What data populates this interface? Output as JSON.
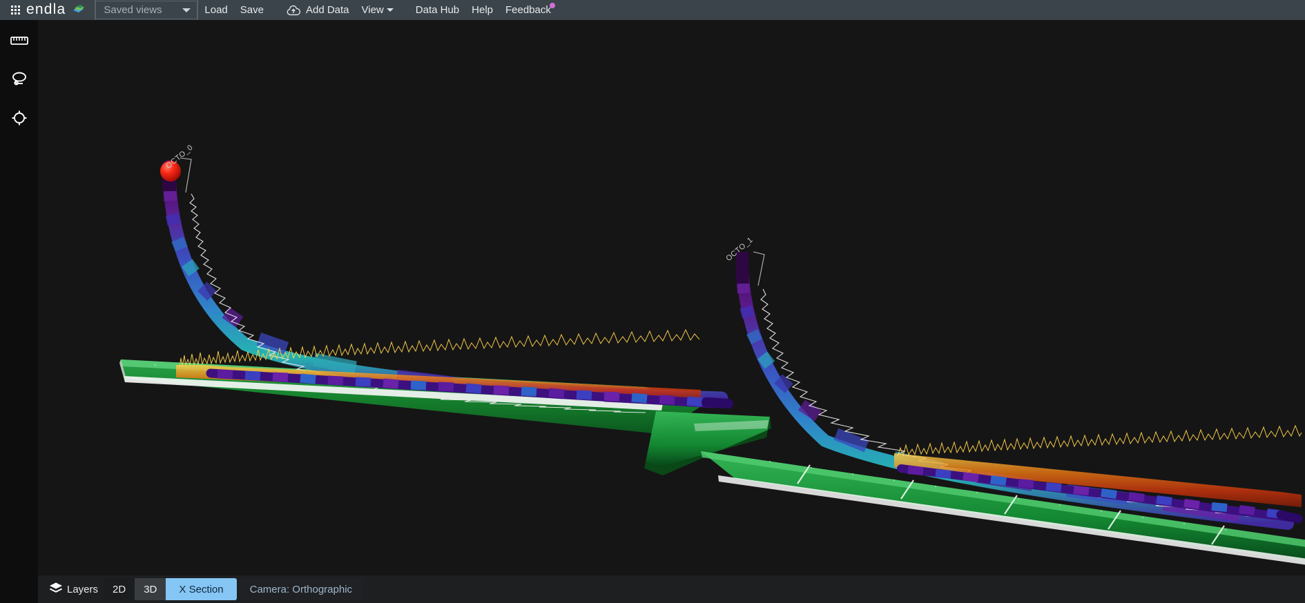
{
  "app": {
    "brand": "endla",
    "brand_icon": "layers-leaf-icon",
    "apps_icon": "apps-grid-icon"
  },
  "toolbar": {
    "saved_views": {
      "label": "Saved views",
      "icon": "chevron-down-icon"
    },
    "load_label": "Load",
    "save_label": "Save",
    "add_data": {
      "label": "Add Data",
      "icon": "cloud-upload-icon"
    },
    "view": {
      "label": "View",
      "icon": "chevron-down-icon"
    },
    "data_hub_label": "Data Hub",
    "help_label": "Help",
    "feedback_label": "Feedback",
    "feedback_badge_color": "#d46fd8"
  },
  "tool_rail": {
    "items": [
      {
        "name": "measure-tool",
        "icon": "ruler-icon"
      },
      {
        "name": "lasso-select-tool",
        "icon": "lasso-icon"
      },
      {
        "name": "target-tool",
        "icon": "crosshair-target-icon"
      }
    ]
  },
  "statusbar": {
    "layers_label": "Layers",
    "layers_icon": "layers-stack-icon",
    "view_modes": [
      {
        "label": "2D",
        "active": false
      },
      {
        "label": "3D",
        "active": false
      },
      {
        "label": "X Section",
        "active": true
      }
    ],
    "camera_label": "Camera: Orthographic",
    "active_color": "#85c6f5"
  },
  "viewport": {
    "background_color": "#151515",
    "wells": [
      {
        "name": "OCTO_0",
        "label": "OCTO_0",
        "marker": "red-sphere-marker",
        "marker_color": "#f51a0e"
      },
      {
        "name": "OCTO_1",
        "label": "OCTO_1",
        "marker": "none",
        "marker_color": ""
      }
    ],
    "surfaces": [
      {
        "name": "horizon-surface-upper",
        "color": "#1b7a36"
      },
      {
        "name": "horizon-surface-lower",
        "color": "#126a2b"
      }
    ],
    "log_curves": [
      {
        "name": "gamma-ray-log",
        "color": "#e8e8e8"
      },
      {
        "name": "resistivity-log",
        "color": "#ef7a18"
      }
    ],
    "trajectory_colormap": "viridis"
  }
}
